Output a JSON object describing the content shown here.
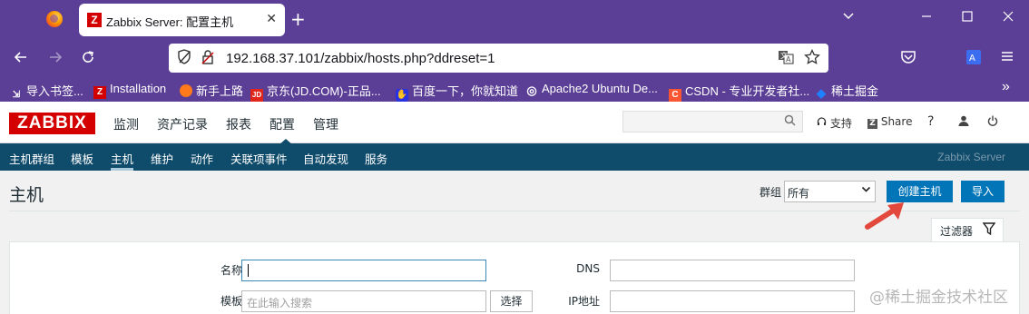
{
  "browser": {
    "tab_title": "Zabbix Server: 配置主机",
    "tab_favicon": "Z",
    "new_tab": "+",
    "tab_close": "✕",
    "url": "192.168.37.101/zabbix/hosts.php?ddreset=1",
    "bookmarks": [
      {
        "label": "导入书签...",
        "icon": "import-icon"
      },
      {
        "label": "Installation",
        "icon": "zabbix-icon"
      },
      {
        "label": "新手上路",
        "icon": "firefox-icon"
      },
      {
        "label": "京东(JD.COM)-正品...",
        "icon": "jd-icon"
      },
      {
        "label": "百度一下，你就知道",
        "icon": "baidu-icon"
      },
      {
        "label": "Apache2 Ubuntu De...",
        "icon": "globe-icon"
      },
      {
        "label": "CSDN - 专业开发者社...",
        "icon": "csdn-icon"
      },
      {
        "label": "稀土掘金",
        "icon": "juejin-icon"
      }
    ]
  },
  "zabbix": {
    "logo": "ZABBIX",
    "menu": [
      "监测",
      "资产记录",
      "报表",
      "配置",
      "管理"
    ],
    "active_menu": "配置",
    "support": "支持",
    "share": "Share",
    "help": "?",
    "submenu": [
      "主机群组",
      "模板",
      "主机",
      "维护",
      "动作",
      "关联项事件",
      "自动发现",
      "服务"
    ],
    "active_submenu": "主机",
    "server_name": "Zabbix Server"
  },
  "page": {
    "title": "主机",
    "group_label": "群组",
    "group_value": "所有",
    "create_host": "创建主机",
    "import": "导入",
    "filter_label": "过滤器",
    "fields": {
      "name_label": "名称",
      "name_value": "",
      "template_label": "模板",
      "template_placeholder": "在此输入搜索",
      "select_button": "选择",
      "dns_label": "DNS",
      "ip_label": "IP地址"
    }
  },
  "watermark": "@稀土掘金技术社区",
  "colors": {
    "browser_chrome": "#5b3f96",
    "zabbix_red": "#d40000",
    "submenu_bg": "#0f4b6b",
    "primary_button": "#0275b8",
    "arrow": "#e2483b"
  }
}
